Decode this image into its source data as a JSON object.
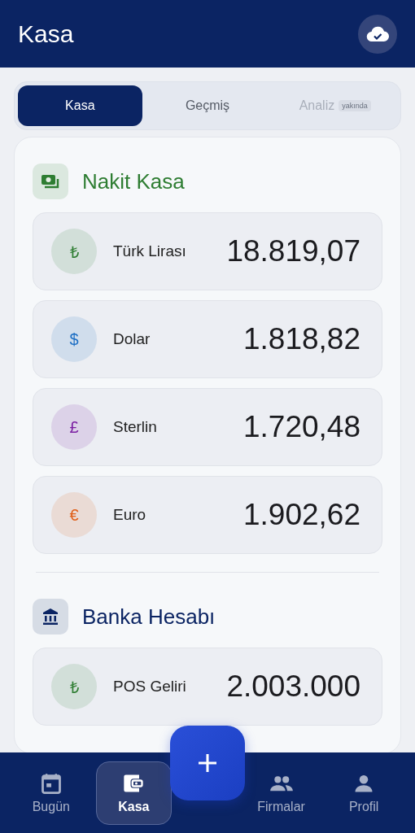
{
  "header": {
    "title": "Kasa"
  },
  "tabs": [
    {
      "label": "Kasa",
      "selected": true,
      "disabled": false
    },
    {
      "label": "Geçmiş",
      "selected": false,
      "disabled": false
    },
    {
      "label": "Analiz",
      "selected": false,
      "disabled": true,
      "badge": "yakında"
    }
  ],
  "sections": [
    {
      "kind": "cash",
      "title": "Nakit Kasa",
      "color": "#2e7d32",
      "accounts": [
        {
          "symbol": "₺",
          "name": "Türk Lirası",
          "amount": "18.819,07",
          "color": "#2e7d32"
        },
        {
          "symbol": "$",
          "name": "Dolar",
          "amount": "1.818,82",
          "color": "#1e6fc4"
        },
        {
          "symbol": "£",
          "name": "Sterlin",
          "amount": "1.720,48",
          "color": "#7b1fa2"
        },
        {
          "symbol": "€",
          "name": "Euro",
          "amount": "1.902,62",
          "color": "#e0601a"
        }
      ]
    },
    {
      "kind": "bank",
      "title": "Banka Hesabı",
      "color": "#0b2463",
      "accounts": [
        {
          "symbol": "₺",
          "name": "POS Geliri",
          "amount": "2.003.000",
          "color": "#2e7d32"
        }
      ]
    }
  ],
  "nav": [
    {
      "kind": "calendar",
      "label": "Bugün",
      "selected": false
    },
    {
      "kind": "wallet",
      "label": "Kasa",
      "selected": true
    },
    {
      "kind": "add",
      "selected": false
    },
    {
      "kind": "people",
      "label": "Firmalar",
      "selected": false
    },
    {
      "kind": "person",
      "label": "Profil",
      "selected": false
    }
  ]
}
